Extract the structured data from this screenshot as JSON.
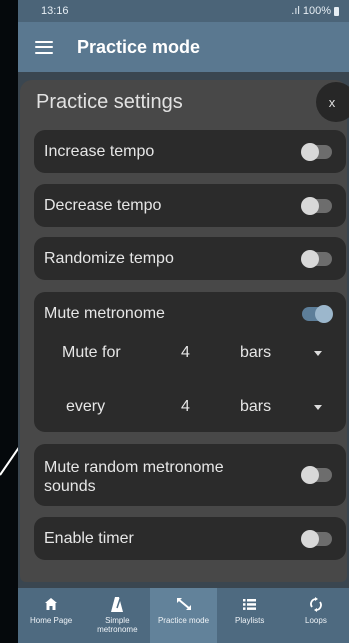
{
  "status_bar": {
    "time": "13:16",
    "signal": ".ıl",
    "battery_text": "100%"
  },
  "app_bar": {
    "title": "Practice mode",
    "menu_icon": "hamburger-menu-icon"
  },
  "dialog": {
    "title": "Practice settings",
    "close_label": "x",
    "rows": {
      "increase_tempo": {
        "label": "Increase tempo",
        "enabled": false
      },
      "decrease_tempo": {
        "label": "Decrease tempo",
        "enabled": false
      },
      "randomize_tempo": {
        "label": "Randomize tempo",
        "enabled": false
      },
      "mute_metronome": {
        "label": "Mute metronome",
        "enabled": true,
        "mute_for": {
          "label": "Mute for",
          "value": "4",
          "unit": "bars"
        },
        "every": {
          "label": "every",
          "value": "4",
          "unit": "bars"
        }
      },
      "mute_random": {
        "label_line1": "Mute random metronome",
        "label_line2": "sounds",
        "enabled": false
      },
      "enable_timer": {
        "label": "Enable timer",
        "enabled": false
      }
    }
  },
  "bottom_nav": {
    "items": [
      {
        "label": "Home Page",
        "icon": "home-icon"
      },
      {
        "label": "Simple metronome",
        "icon": "metronome-icon"
      },
      {
        "label": "Practice mode",
        "icon": "practice-icon",
        "active": true
      },
      {
        "label": "Playlists",
        "icon": "list-icon"
      },
      {
        "label": "Loops",
        "icon": "loop-icon"
      }
    ]
  },
  "colors": {
    "app_bar": "#5a7890",
    "dialog": "#484848",
    "row": "#2b2b2b",
    "toggle_on": "#5d7e99"
  }
}
